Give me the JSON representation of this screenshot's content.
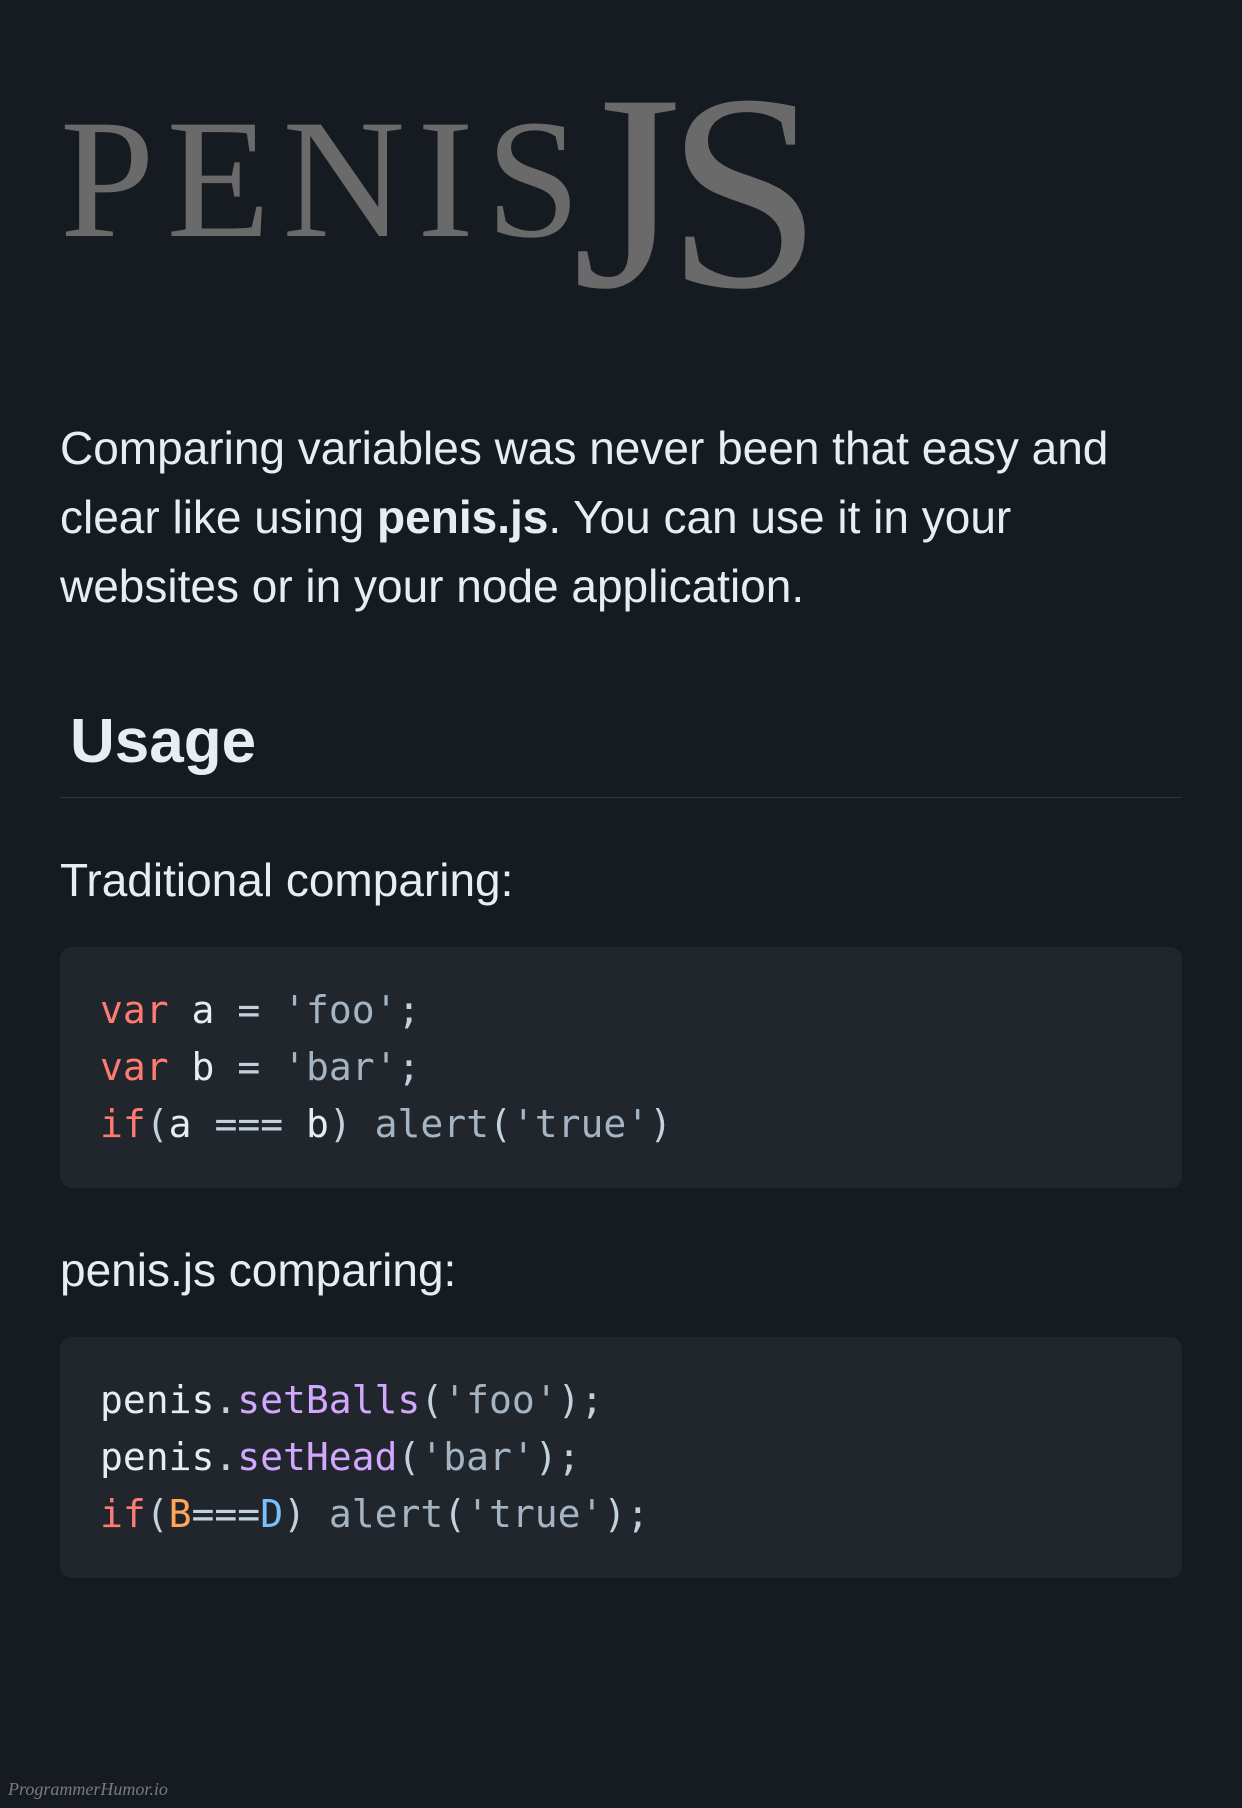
{
  "logo": {
    "part1": "PENIS",
    "part2": "JS"
  },
  "description": {
    "prefix": "Comparing variables was never been that easy and clear like using ",
    "strong": "penis.js",
    "suffix": ". You can use it in your websites or in your node application."
  },
  "usage_heading": "Usage",
  "section1": {
    "heading": "Traditional comparing:",
    "code": {
      "line1": {
        "kw": "var",
        "var": "a",
        "op": "=",
        "str": "'foo'",
        "end": ";"
      },
      "line2": {
        "kw": "var",
        "var": "b",
        "op": "=",
        "str": "'bar'",
        "end": ";"
      },
      "line3": {
        "kw": "if",
        "open": "(",
        "var1": "a",
        "op": "===",
        "var2": "b",
        "close": ")",
        "fn": "alert",
        "fopen": "(",
        "str": "'true'",
        "fclose": ")"
      }
    }
  },
  "section2": {
    "heading": "penis.js comparing:",
    "code": {
      "line1": {
        "obj": "penis",
        "dot": ".",
        "method": "setBalls",
        "open": "(",
        "str": "'foo'",
        "close": ")",
        "end": ";"
      },
      "line2": {
        "obj": "penis",
        "dot": ".",
        "method": "setHead",
        "open": "(",
        "str": "'bar'",
        "close": ")",
        "end": ";"
      },
      "line3": {
        "kw": "if",
        "open": "(",
        "B": "B",
        "op": "===",
        "D": "D",
        "close": ")",
        "fn": "alert",
        "fopen": "(",
        "str": "'true'",
        "fclose": ")",
        "end": ";"
      }
    }
  },
  "watermark": "ProgrammerHumor.io"
}
